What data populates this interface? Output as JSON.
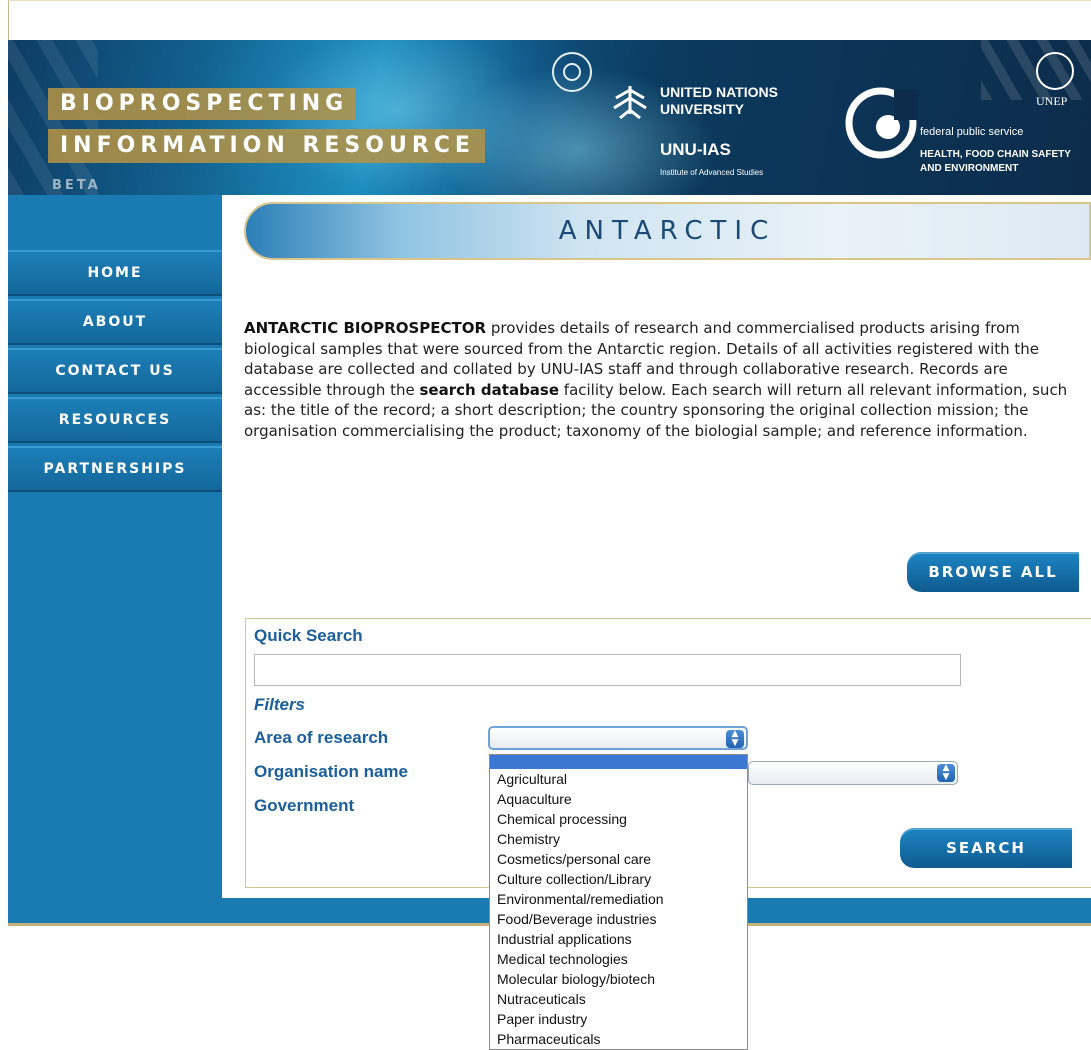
{
  "header": {
    "title_line1": "BIOPROSPECTING",
    "title_line2": "INFORMATION RESOURCE",
    "beta": "BETA",
    "unu_name": "UNITED NATIONS\nUNIVERSITY",
    "unu_ias": "UNU-IAS",
    "unu_sub": "Institute of Advanced Studies",
    "fps_line1": "federal public service",
    "fps_line2": "HEALTH, FOOD CHAIN SAFETY\nAND ENVIRONMENT",
    "unep": "UNEP",
    "icons": [
      "un-emblem-icon",
      "unu-logo-icon",
      "federal-public-service-logo-icon",
      "unep-logo-icon"
    ]
  },
  "nav": {
    "items": [
      {
        "label": "HOME"
      },
      {
        "label": "ABOUT"
      },
      {
        "label": "CONTACT US"
      },
      {
        "label": "RESOURCES"
      },
      {
        "label": "PARTNERSHIPS"
      }
    ]
  },
  "page": {
    "title": "ANTARCTIC",
    "intro_bold1": "ANTARCTIC BIOPROSPECTOR",
    "intro_text1": " provides details of research and commercialised products arising from biological samples that were sourced from the Antarctic region. Details of all activities registered with the database are collected and collated by UNU-IAS staff and through collaborative research. Records are accessible through the ",
    "intro_bold2": "search database",
    "intro_text2": " facility below. Each search will return all relevant information, such as: the title of the record; a short description; the country sponsoring the original collection mission; the organisation commercialising the product; taxonomy of the biologial sample; and reference information.",
    "browse_all": "BROWSE ALL"
  },
  "search": {
    "quick_search_label": "Quick Search",
    "quick_search_value": "",
    "filters_label": "Filters",
    "area_label": "Area of research",
    "organisation_label": "Organisation name",
    "government_label": "Government",
    "area_selected": "",
    "organisation_selected": "",
    "search_button": "SEARCH",
    "area_options": [
      "Agricultural",
      "Aquaculture",
      "Chemical processing",
      "Chemistry",
      "Cosmetics/personal care",
      "Culture collection/Library",
      "Environmental/remediation",
      "Food/Beverage industries",
      "Industrial applications",
      "Medical technologies",
      "Molecular biology/biotech",
      "Nutraceuticals",
      "Paper industry",
      "Pharmaceuticals"
    ]
  },
  "colors": {
    "nav_blue": "#1a7ab2",
    "title_gold": "#b09246",
    "label_blue": "#1a5f99",
    "selection_blue": "#3a78d4"
  }
}
